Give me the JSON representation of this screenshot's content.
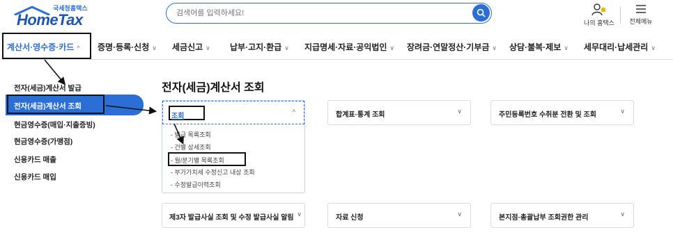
{
  "header": {
    "logo_sub": "국세청홈택스",
    "logo_main": "HomeTax",
    "search_placeholder": "검색어를 입력하세요!",
    "my_hometax": "나의 홈택스",
    "all_menu": "전체메뉴"
  },
  "nav": {
    "items": [
      {
        "label": "계산서·영수증·카드",
        "chevron": "^"
      },
      {
        "label": "증명·등록·신청",
        "chevron": "∨"
      },
      {
        "label": "세금신고",
        "chevron": "∨"
      },
      {
        "label": "납부·고지·환급",
        "chevron": "∨"
      },
      {
        "label": "지급명세·자료·공익법인",
        "chevron": "∨"
      },
      {
        "label": "장려금·연말정산·기부금",
        "chevron": "∨"
      },
      {
        "label": "상담·불복·제보",
        "chevron": "∨"
      },
      {
        "label": "세무대리·납세관리",
        "chevron": "∨"
      }
    ]
  },
  "sidebar": {
    "items": [
      {
        "label": "전자(세금)계산서 발급"
      },
      {
        "label": "전자(세금)계산서 조회"
      },
      {
        "label": "현금영수증(매입·지출증빙)"
      },
      {
        "label": "현금영수증(가맹점)"
      },
      {
        "label": "신용카드 매출"
      },
      {
        "label": "신용카드 매입"
      }
    ]
  },
  "main": {
    "title": "전자(세금)계산서 조회",
    "open_card": {
      "label": "조회",
      "chevron": "^",
      "sub_items": [
        "- 발급 목록조회",
        "- 건별 상세조회",
        "- 월/분기별 목록조회",
        "- 부가가치세 수정신고 내상 조회",
        "- 수정발급이력조회"
      ]
    },
    "cards": [
      {
        "label": "합계표·통계 조회",
        "chevron": "∨"
      },
      {
        "label": "주민등록번호 수취분 전환 및 조회",
        "chevron": "∨"
      },
      {
        "label": "제3자 발급사실 조회 및 수정 발급사실 알림",
        "chevron": "∨"
      },
      {
        "label": "자료 신청",
        "chevron": "∨"
      },
      {
        "label": "본지점·총괄납부 조회권한 관리",
        "chevron": "∨"
      }
    ]
  },
  "colors": {
    "brand": "#2b6fd6",
    "annotation": "#111111"
  }
}
